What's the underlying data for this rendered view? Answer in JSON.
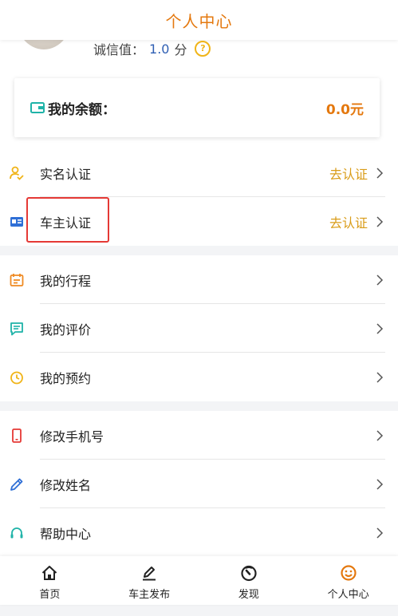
{
  "header": {
    "title": "个人中心"
  },
  "profile": {
    "credit_label": "诚信值：",
    "credit_value": "1.0",
    "credit_unit": "分",
    "help_icon": "question-circle-icon"
  },
  "balance": {
    "label": "我的余额：",
    "amount": "0.0元",
    "icon": "wallet-icon"
  },
  "colors": {
    "accent": "#e4780e",
    "action": "#d99c18",
    "highlight": "#e53935"
  },
  "groups": [
    {
      "items": [
        {
          "label": "实名认证",
          "action": "去认证",
          "icon": "user-check-icon"
        },
        {
          "label": "车主认证",
          "action": "去认证",
          "icon": "id-card-icon"
        }
      ]
    },
    {
      "items": [
        {
          "label": "我的行程",
          "icon": "calendar-icon"
        },
        {
          "label": "我的评价",
          "icon": "comment-icon"
        },
        {
          "label": "我的预约",
          "icon": "clock-icon"
        }
      ]
    },
    {
      "items": [
        {
          "label": "修改手机号",
          "icon": "phone-icon"
        },
        {
          "label": "修改姓名",
          "icon": "pencil-icon"
        },
        {
          "label": "帮助中心",
          "icon": "headset-icon"
        }
      ]
    }
  ],
  "tabbar": [
    {
      "label": "首页",
      "icon": "home-icon"
    },
    {
      "label": "车主发布",
      "icon": "edit-icon"
    },
    {
      "label": "发现",
      "icon": "compass-icon"
    },
    {
      "label": "个人中心",
      "icon": "smile-icon"
    }
  ]
}
